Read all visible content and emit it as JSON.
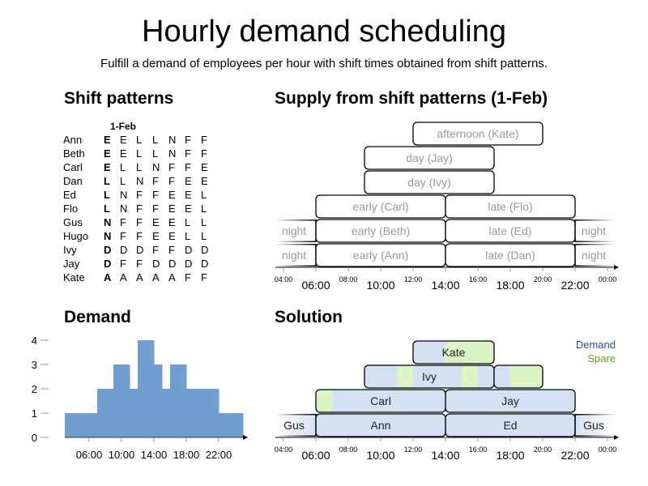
{
  "header": {
    "title": "Hourly demand scheduling",
    "subtitle": "Fulfill a demand of employees per hour with shift times obtained from shift patterns."
  },
  "sections": {
    "patterns": "Shift patterns",
    "supply": "Supply from shift patterns (1-Feb)",
    "demand": "Demand",
    "solution": "Solution"
  },
  "patterns": {
    "column_header": "1-Feb",
    "rows": [
      {
        "name": "Ann",
        "codes": [
          "E",
          "E",
          "L",
          "L",
          "N",
          "F",
          "F"
        ]
      },
      {
        "name": "Beth",
        "codes": [
          "E",
          "E",
          "L",
          "L",
          "N",
          "F",
          "F"
        ]
      },
      {
        "name": "Carl",
        "codes": [
          "E",
          "L",
          "L",
          "N",
          "F",
          "F",
          "E"
        ]
      },
      {
        "name": "Dan",
        "codes": [
          "L",
          "L",
          "N",
          "F",
          "F",
          "E",
          "E"
        ]
      },
      {
        "name": "Ed",
        "codes": [
          "L",
          "N",
          "F",
          "F",
          "E",
          "E",
          "L"
        ]
      },
      {
        "name": "Flo",
        "codes": [
          "L",
          "N",
          "F",
          "F",
          "E",
          "E",
          "L"
        ]
      },
      {
        "name": "Gus",
        "codes": [
          "N",
          "F",
          "F",
          "E",
          "E",
          "L",
          "L"
        ]
      },
      {
        "name": "Hugo",
        "codes": [
          "N",
          "F",
          "F",
          "E",
          "E",
          "L",
          "L"
        ]
      },
      {
        "name": "Ivy",
        "codes": [
          "D",
          "D",
          "D",
          "F",
          "F",
          "D",
          "D"
        ]
      },
      {
        "name": "Jay",
        "codes": [
          "D",
          "F",
          "F",
          "D",
          "D",
          "D",
          "D"
        ]
      },
      {
        "name": "Kate",
        "codes": [
          "A",
          "A",
          "A",
          "A",
          "A",
          "F",
          "F"
        ]
      }
    ]
  },
  "colors": {
    "demand": "#2c4f8c",
    "spare": "#5fa81e",
    "demand_fill": "#d3e1f2",
    "spare_fill": "#daf5c2",
    "bar": "#6f9ecf",
    "label_gray": "#999999"
  },
  "timeline": {
    "minor_ticks": [
      "04:00",
      "08:00",
      "12:00",
      "16:00",
      "20:00",
      "00:00"
    ],
    "major_ticks": [
      "06:00",
      "10:00",
      "14:00",
      "18:00",
      "22:00"
    ]
  },
  "supply": {
    "shifts": [
      {
        "label": "night",
        "start": 22,
        "end": 6,
        "row": 0,
        "fade": "left"
      },
      {
        "label": "early (Ann)",
        "start": 6,
        "end": 14,
        "row": 0
      },
      {
        "label": "late (Dan)",
        "start": 14,
        "end": 22,
        "row": 0
      },
      {
        "label": "night",
        "start": 22,
        "end": 30,
        "row": 0,
        "fade": "right"
      },
      {
        "label": "night",
        "start": 22,
        "end": 6,
        "row": 1,
        "fade": "left"
      },
      {
        "label": "early (Beth)",
        "start": 6,
        "end": 14,
        "row": 1
      },
      {
        "label": "late (Ed)",
        "start": 14,
        "end": 22,
        "row": 1
      },
      {
        "label": "night",
        "start": 22,
        "end": 30,
        "row": 1,
        "fade": "right"
      },
      {
        "label": "early (Carl)",
        "start": 6,
        "end": 14,
        "row": 2
      },
      {
        "label": "late (Flo)",
        "start": 14,
        "end": 22,
        "row": 2
      },
      {
        "label": "day (Ivy)",
        "start": 9,
        "end": 17,
        "row": 3
      },
      {
        "label": "day (Jay)",
        "start": 9,
        "end": 17,
        "row": 4
      },
      {
        "label": "afternoon (Kate)",
        "start": 12,
        "end": 20,
        "row": 5
      }
    ]
  },
  "solution": {
    "legend": {
      "demand": "Demand",
      "spare": "Spare"
    },
    "shifts": [
      {
        "label": "Gus",
        "start": 22,
        "end": 6,
        "row": 0,
        "fade": "left",
        "spare": []
      },
      {
        "label": "Ann",
        "start": 6,
        "end": 14,
        "row": 0,
        "spare": []
      },
      {
        "label": "Ed",
        "start": 14,
        "end": 22,
        "row": 0,
        "spare": []
      },
      {
        "label": "Gus",
        "start": 22,
        "end": 30,
        "row": 0,
        "fade": "right",
        "spare": []
      },
      {
        "label": "Carl",
        "start": 6,
        "end": 14,
        "row": 1,
        "spare": [
          [
            6,
            7
          ]
        ]
      },
      {
        "label": "Jay",
        "start": 14,
        "end": 22,
        "row": 1,
        "spare": []
      },
      {
        "label": "Ivy",
        "start": 9,
        "end": 17,
        "row": 2,
        "spare": [
          [
            11,
            12
          ],
          [
            15,
            16
          ]
        ]
      },
      {
        "label": "",
        "start": 17,
        "end": 20,
        "row": 2,
        "spare": [
          [
            18,
            20
          ]
        ]
      },
      {
        "label": "Kate",
        "start": 12,
        "end": 17,
        "row": 3,
        "spare": [
          [
            14,
            17
          ]
        ]
      }
    ]
  },
  "chart_data": {
    "type": "bar",
    "title": "Demand",
    "xlabel": "",
    "ylabel": "",
    "ylim": [
      0,
      4
    ],
    "yticks": [
      "0",
      "1",
      "2",
      "3",
      "4"
    ],
    "xticks": [
      "06:00",
      "10:00",
      "14:00",
      "18:00",
      "22:00"
    ],
    "categories": [
      "03:00",
      "04:00",
      "05:00",
      "06:00",
      "07:00",
      "08:00",
      "09:00",
      "10:00",
      "11:00",
      "12:00",
      "13:00",
      "14:00",
      "15:00",
      "16:00",
      "17:00",
      "18:00",
      "19:00",
      "20:00",
      "21:00",
      "22:00",
      "23:00",
      "00:00"
    ],
    "values": [
      1,
      1,
      1,
      1,
      2,
      2,
      3,
      3,
      2,
      4,
      4,
      3,
      2,
      3,
      3,
      2,
      2,
      2,
      2,
      1,
      1,
      1
    ]
  }
}
